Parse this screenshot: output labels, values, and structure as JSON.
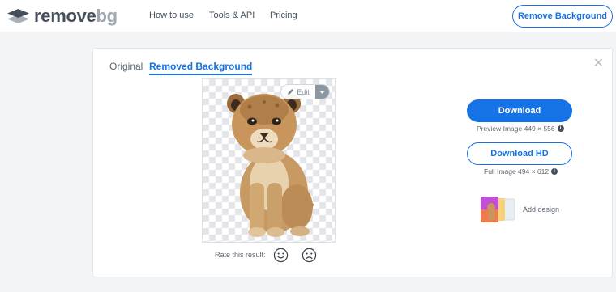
{
  "brand": {
    "name_a": "remove",
    "name_b": "bg"
  },
  "nav": {
    "how_to_use": "How to use",
    "tools_api": "Tools & API",
    "pricing": "Pricing",
    "cta": "Remove Background"
  },
  "tabs": {
    "original": "Original",
    "removed": "Removed Background"
  },
  "close_glyph": "✕",
  "editor": {
    "edit_label": "Edit"
  },
  "rating": {
    "prompt": "Rate this result:"
  },
  "download": {
    "primary_label": "Download",
    "preview_text": "Preview Image 449 × 556",
    "hd_label": "Download HD",
    "full_text": "Full Image 494 × 612",
    "info_glyph": "i"
  },
  "design": {
    "label": "Add design"
  },
  "colors": {
    "accent": "#1673e5",
    "text": "#454f5b",
    "muted": "#a1a8b1",
    "checker": "#e4e6e9"
  }
}
